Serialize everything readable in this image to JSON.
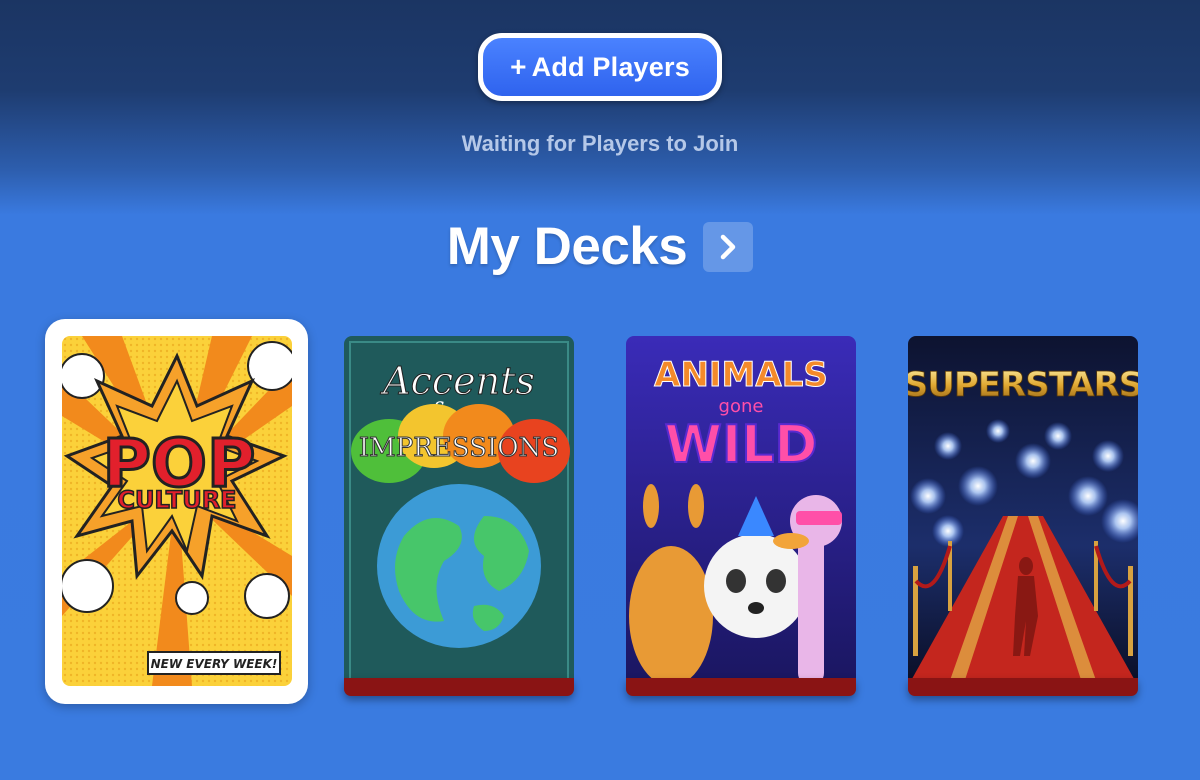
{
  "header": {
    "add_players_label": "Add Players",
    "add_players_icon": "plus-icon",
    "waiting_text": "Waiting for Players to Join"
  },
  "decks_section": {
    "title": "My Decks",
    "more_icon": "chevron-right-icon"
  },
  "decks": [
    {
      "title_line1": "POP",
      "title_line2": "CULTURE",
      "badge": "NEW EVERY WEEK!",
      "selected": true
    },
    {
      "title_line1": "Accents",
      "title_amp": "&",
      "title_line2": "IMPRESSIONS",
      "selected": false
    },
    {
      "title_line1": "ANIMALS",
      "title_mid": "gone",
      "title_line2": "WILD",
      "selected": false
    },
    {
      "title_line1": "SUPERSTARS",
      "selected": false
    }
  ],
  "colors": {
    "accent_blue": "#3a7be0",
    "button_blue": "#3b6ff5",
    "header_navy": "#1b3563",
    "deck_base_red": "#8a1414"
  }
}
